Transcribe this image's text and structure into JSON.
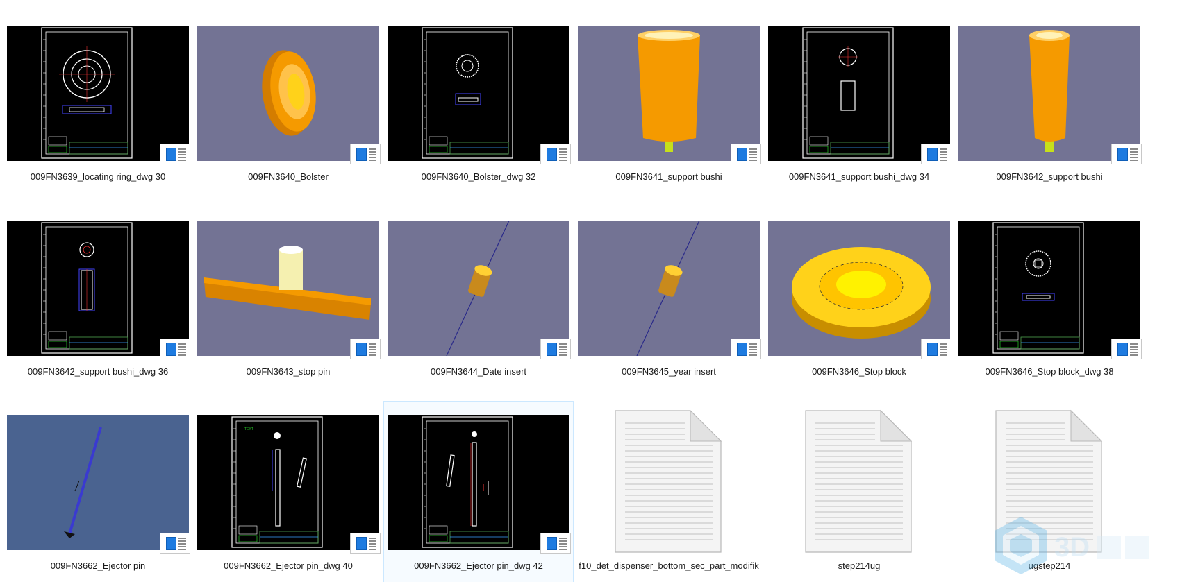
{
  "files": [
    {
      "name": "009FN3639_locating ring_dwg 30",
      "kind": "drawing",
      "variant": "ring"
    },
    {
      "name": "009FN3640_Bolster",
      "kind": "model",
      "variant": "bolster"
    },
    {
      "name": "009FN3640_Bolster_dwg 32",
      "kind": "drawing",
      "variant": "ring-small"
    },
    {
      "name": "009FN3641_support bushi",
      "kind": "model",
      "variant": "bushi"
    },
    {
      "name": "009FN3641_support bushi_dwg 34",
      "kind": "drawing",
      "variant": "bushi"
    },
    {
      "name": "009FN3642_support bushi",
      "kind": "model",
      "variant": "bushi-thin"
    },
    {
      "name": "009FN3642_support bushi_dwg 36",
      "kind": "drawing",
      "variant": "bushi-long"
    },
    {
      "name": "009FN3643_stop pin",
      "kind": "model",
      "variant": "stoppin"
    },
    {
      "name": "009FN3644_Date insert",
      "kind": "model",
      "variant": "insert"
    },
    {
      "name": "009FN3645_year insert",
      "kind": "model",
      "variant": "insert"
    },
    {
      "name": "009FN3646_Stop block",
      "kind": "model",
      "variant": "stopblock"
    },
    {
      "name": "009FN3646_Stop block_dwg 38",
      "kind": "drawing",
      "variant": "ring-flat"
    },
    {
      "name": "009FN3662_Ejector pin",
      "kind": "model",
      "variant": "ejector"
    },
    {
      "name": "009FN3662_Ejector pin_dwg 40",
      "kind": "drawing",
      "variant": "pins"
    },
    {
      "name": "009FN3662_Ejector pin_dwg 42",
      "kind": "drawing",
      "variant": "pins2",
      "selected": true
    },
    {
      "name": "f10_det_dispenser_bottom_sec_part_modifik",
      "kind": "document"
    },
    {
      "name": "step214ug",
      "kind": "document"
    },
    {
      "name": "ugstep214",
      "kind": "document"
    }
  ],
  "colors": {
    "cad_background": "#000000",
    "model_background": "#737394",
    "ejector_background": "#4a6390",
    "part_orange": "#f59a00",
    "part_yellow": "#ffd21a",
    "badge_blue": "#1e7be0",
    "selection": "#cce8ff"
  },
  "icons": {
    "file_type_badge": "app-file-badge-icon",
    "plain_document": "generic-document-icon",
    "watermark": "3d-cube-watermark-icon"
  }
}
